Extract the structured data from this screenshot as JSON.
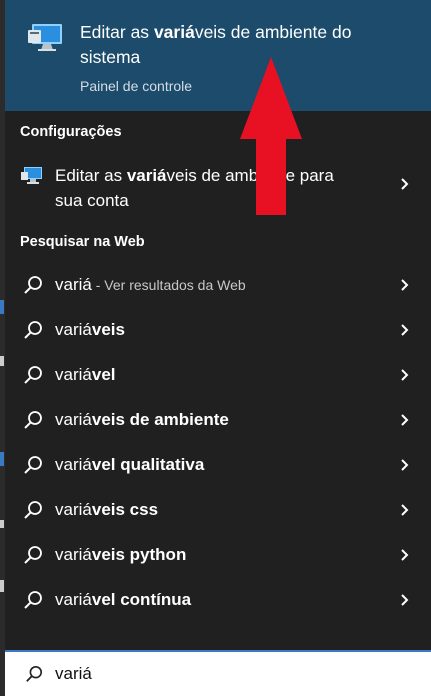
{
  "best_match": {
    "title_pre": "Editar as ",
    "title_bold": "variá",
    "title_post": "veis de ambiente do sistema",
    "subtitle": "Painel de controle",
    "icon": "monitor-settings-icon"
  },
  "sections": {
    "settings": "Configurações",
    "web": "Pesquisar na Web"
  },
  "settings_item": {
    "pre": "Editar as ",
    "bold": "variá",
    "post": "veis de ambiente para sua conta",
    "icon": "monitor-settings-icon"
  },
  "web_results": [
    {
      "pre": "variá",
      "bold": "",
      "suffix": " - Ver resultados da Web"
    },
    {
      "pre": "variá",
      "bold": "veis",
      "suffix": ""
    },
    {
      "pre": "variá",
      "bold": "vel",
      "suffix": ""
    },
    {
      "pre": "variá",
      "bold": "veis de ambiente",
      "suffix": ""
    },
    {
      "pre": "variá",
      "bold": "vel qualitativa",
      "suffix": ""
    },
    {
      "pre": "variá",
      "bold": "veis css",
      "suffix": ""
    },
    {
      "pre": "variá",
      "bold": "veis python",
      "suffix": ""
    },
    {
      "pre": "variá",
      "bold": "vel contínua",
      "suffix": ""
    }
  ],
  "search": {
    "value": "variá",
    "icon": "search-icon"
  },
  "colors": {
    "panel_bg": "#202020",
    "highlight_bg": "#1c4b6b",
    "annotation_arrow": "#e81123"
  }
}
